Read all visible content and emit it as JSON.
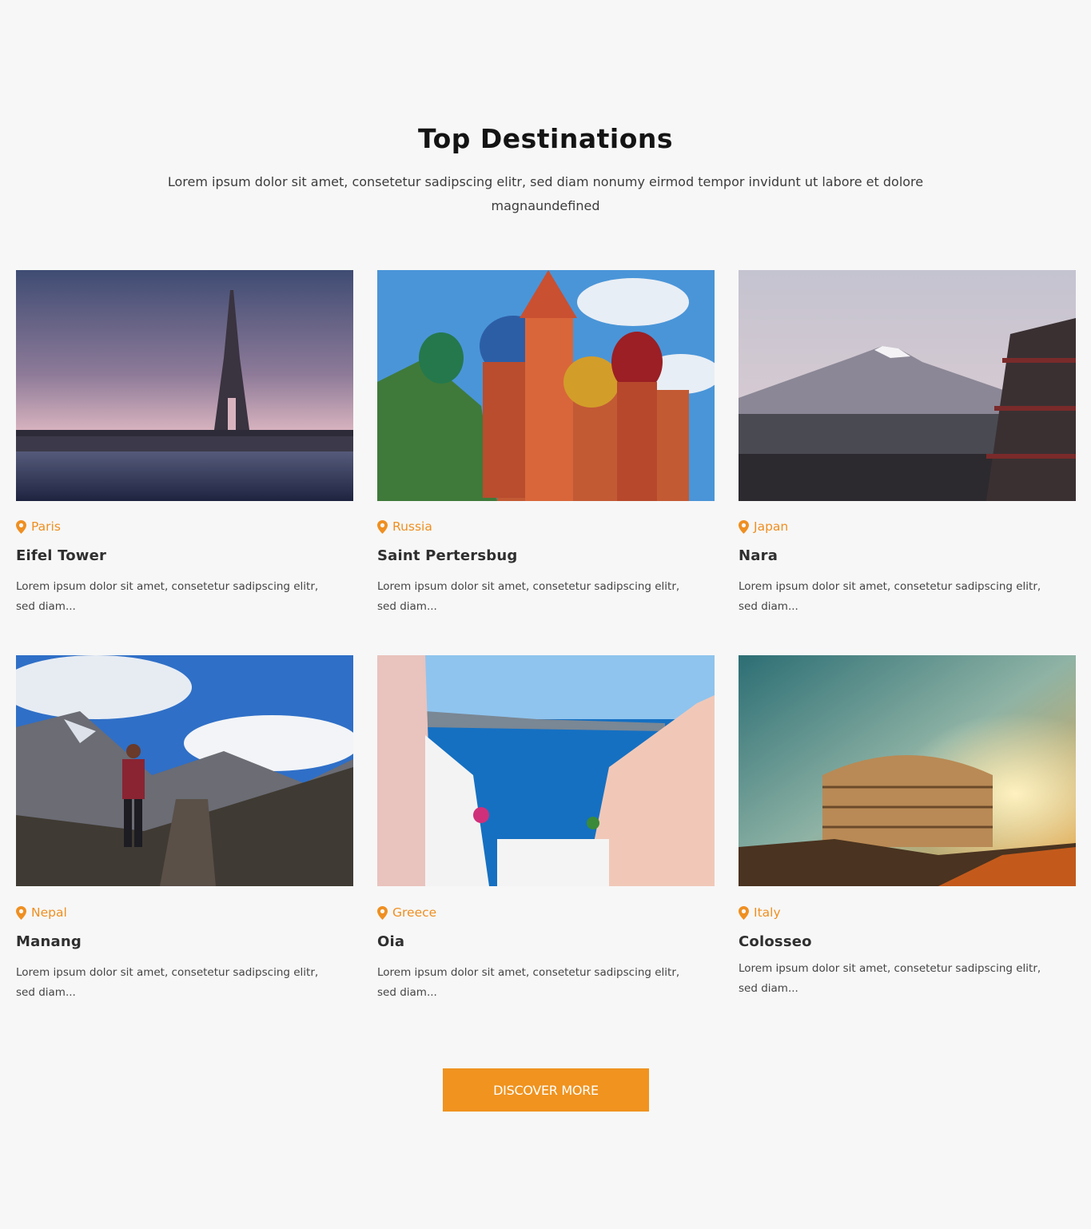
{
  "section": {
    "title": "Top Destinations",
    "intro": "Lorem ipsum dolor sit amet, consetetur sadipscing elitr, sed diam nonumy eirmod tempor invidunt ut labore et dolore magnaundefined"
  },
  "colors": {
    "accent": "#f0931f",
    "location": "#ef8f21",
    "background": "#f7f7f7"
  },
  "destinations": [
    {
      "location": "Paris",
      "name": "Eifel Tower",
      "desc": "Lorem ipsum dolor sit amet, consetetur sadipscing elitr, sed diam...",
      "icon": "map-pin-icon"
    },
    {
      "location": "Russia",
      "name": "Saint Pertersbug",
      "desc": "Lorem ipsum dolor sit amet, consetetur sadipscing elitr, sed diam...",
      "icon": "map-pin-icon"
    },
    {
      "location": "Japan",
      "name": "Nara",
      "desc": "Lorem ipsum dolor sit amet, consetetur sadipscing elitr, sed diam...",
      "icon": "map-pin-icon"
    },
    {
      "location": "Nepal",
      "name": "Manang",
      "desc": "Lorem ipsum dolor sit amet, consetetur sadipscing elitr, sed diam...",
      "icon": "map-pin-icon"
    },
    {
      "location": "Greece",
      "name": "Oia",
      "desc": "Lorem ipsum dolor sit amet, consetetur sadipscing elitr, sed diam...",
      "icon": "map-pin-icon"
    },
    {
      "location": "Italy",
      "name": "Colosseo",
      "desc": "Lorem ipsum dolor sit amet, consetetur sadipscing elitr, sed diam...",
      "icon": "map-pin-icon"
    }
  ],
  "cta": {
    "label": "DISCOVER MORE"
  }
}
